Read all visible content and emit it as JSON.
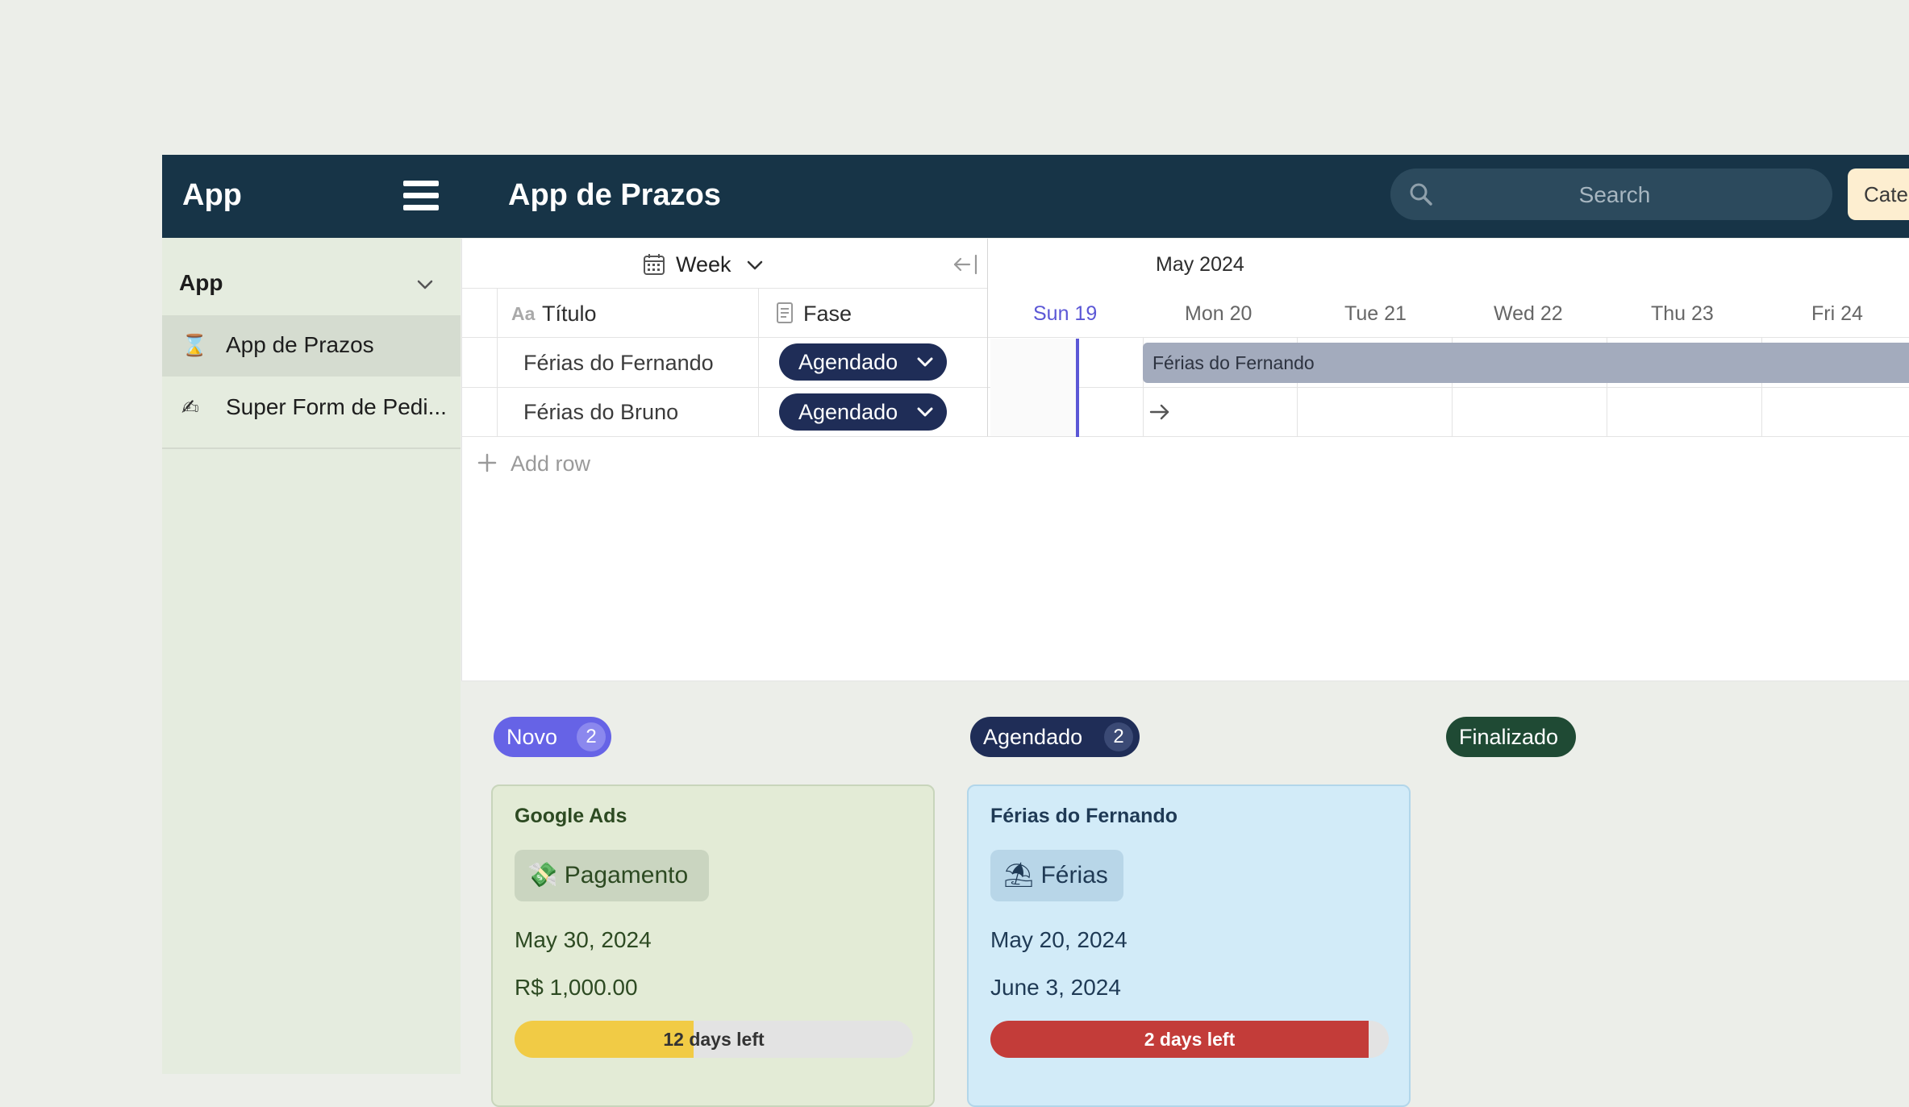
{
  "app": {
    "brand": "App",
    "page_title": "App de Prazos",
    "search_placeholder": "Search",
    "category_button": "Cate"
  },
  "sidebar": {
    "section_title": "App",
    "items": [
      {
        "icon": "⌛",
        "icon_name": "hourglass-icon",
        "label": "App de Prazos",
        "active": true
      },
      {
        "icon": "✍",
        "icon_name": "writing-hand-icon",
        "label": "Super Form de Pedi...",
        "active": false
      }
    ]
  },
  "timeline": {
    "view": "Week",
    "month": "May 2024",
    "columns": {
      "title": "Título",
      "phase": "Fase"
    },
    "title_icon_text": "Aa",
    "days": [
      "Sun 19",
      "Mon 20",
      "Tue 21",
      "Wed 22",
      "Thu 23",
      "Fri 24"
    ],
    "today": "Sun 19",
    "rows": [
      {
        "title": "Férias do Fernando",
        "phase": "Agendado",
        "bar_label": "Férias do Fernando"
      },
      {
        "title": "Férias do Bruno",
        "phase": "Agendado"
      }
    ],
    "add_row": "Add row"
  },
  "board": {
    "groups": [
      {
        "name": "Novo",
        "count": "2",
        "color": "#6663e6"
      },
      {
        "name": "Agendado",
        "count": "2",
        "color": "#1f2d57"
      },
      {
        "name": "Finalizado",
        "color": "#1f4a34"
      }
    ],
    "cards": [
      {
        "title": "Google Ads",
        "tag_icon": "💸",
        "tag": "Pagamento",
        "line1": "May 30, 2024",
        "line2": "R$ 1,000.00",
        "progress_label": "12 days left",
        "progress": 0.45,
        "progress_color": "#f1cb45"
      },
      {
        "title": "Férias do Fernando",
        "tag_icon": "⛱",
        "tag": "Férias",
        "line1": "May 20, 2024",
        "line2": "June 3, 2024",
        "progress_label": "2 days left",
        "progress": 0.95,
        "progress_color": "#c33c39"
      }
    ]
  }
}
